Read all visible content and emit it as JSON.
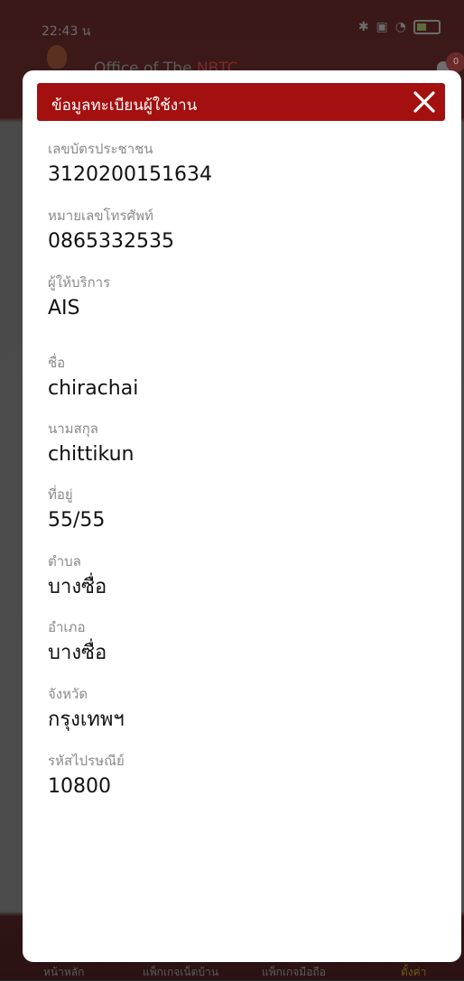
{
  "status_bar": {
    "time": "22:43 น"
  },
  "background": {
    "title_prefix": "Office of The",
    "title_accent": "NBTC",
    "badge_count": "0",
    "nav": [
      "หน้าหลัก",
      "แพ็กเกจเน็ตบ้าน",
      "แพ็กเกจมือถือ",
      "ตั้งค่า"
    ]
  },
  "modal": {
    "title": "ข้อมูลทะเบียนผู้ใช้งาน",
    "fields": [
      {
        "label": "เลขบัตรประชาชน",
        "value": "3120200151634"
      },
      {
        "label": "หมายเลขโทรศัพท์",
        "value": "0865332535"
      },
      {
        "label": "ผู้ให้บริการ",
        "value": "AIS"
      },
      {
        "label": "ชื่อ",
        "value": "chirachai"
      },
      {
        "label": "นามสกุล",
        "value": "chittikun"
      },
      {
        "label": "ที่อยู่",
        "value": "55/55"
      },
      {
        "label": "ตำบล",
        "value": "บางซื่อ"
      },
      {
        "label": "อำเภอ",
        "value": "บางซื่อ"
      },
      {
        "label": "จังหวัด",
        "value": "กรุงเทพฯ"
      },
      {
        "label": "รหัสไปรษณีย์",
        "value": "10800"
      }
    ]
  },
  "colors": {
    "header_red": "#a40f0f",
    "overlay": "#4c4c4c"
  }
}
